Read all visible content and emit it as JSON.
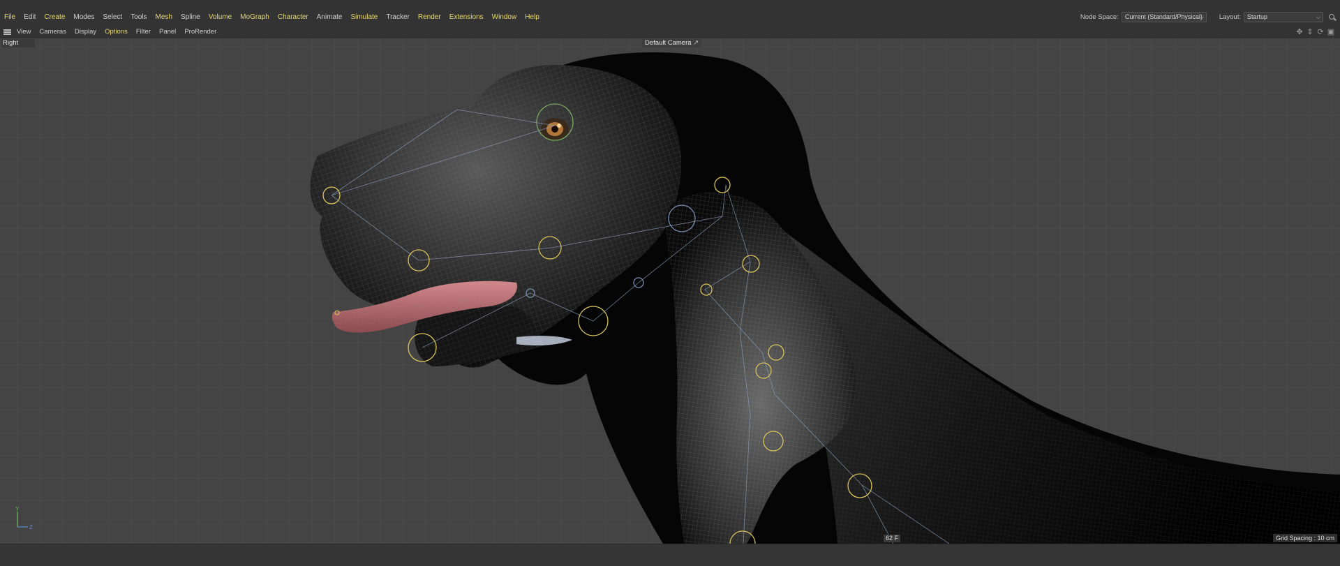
{
  "menubar": {
    "items": [
      {
        "label": "File",
        "hl": true
      },
      {
        "label": "Edit",
        "hl": false
      },
      {
        "label": "Create",
        "hl": true
      },
      {
        "label": "Modes",
        "hl": false
      },
      {
        "label": "Select",
        "hl": false
      },
      {
        "label": "Tools",
        "hl": false
      },
      {
        "label": "Mesh",
        "hl": true
      },
      {
        "label": "Spline",
        "hl": false
      },
      {
        "label": "Volume",
        "hl": true
      },
      {
        "label": "MoGraph",
        "hl": true
      },
      {
        "label": "Character",
        "hl": true
      },
      {
        "label": "Animate",
        "hl": false
      },
      {
        "label": "Simulate",
        "hl": true
      },
      {
        "label": "Tracker",
        "hl": false
      },
      {
        "label": "Render",
        "hl": true
      },
      {
        "label": "Extensions",
        "hl": true
      },
      {
        "label": "Window",
        "hl": true
      },
      {
        "label": "Help",
        "hl": true
      }
    ],
    "node_space_label": "Node Space:",
    "node_space_value": "Current (Standard/Physical)",
    "layout_label": "Layout:",
    "layout_value": "Startup",
    "highlight_color": "#e7d96a"
  },
  "viewport_menu": {
    "items": [
      {
        "label": "View",
        "hl": false
      },
      {
        "label": "Cameras",
        "hl": false
      },
      {
        "label": "Display",
        "hl": false
      },
      {
        "label": "Options",
        "hl": true
      },
      {
        "label": "Filter",
        "hl": false
      },
      {
        "label": "Panel",
        "hl": false
      },
      {
        "label": "ProRender",
        "hl": false
      }
    ],
    "nav_icons": [
      "move-icon",
      "zoom-icon",
      "rotate-icon",
      "maximize-icon"
    ]
  },
  "viewport": {
    "view_name": "Right",
    "camera": "Default Camera",
    "frame": "62 F",
    "grid_spacing": "Grid Spacing : 10 cm",
    "axis_labels": {
      "y": "Y",
      "z": "Z"
    },
    "background": "#444444",
    "grid_color": "#525252",
    "joint_color": "#d8c45a"
  }
}
